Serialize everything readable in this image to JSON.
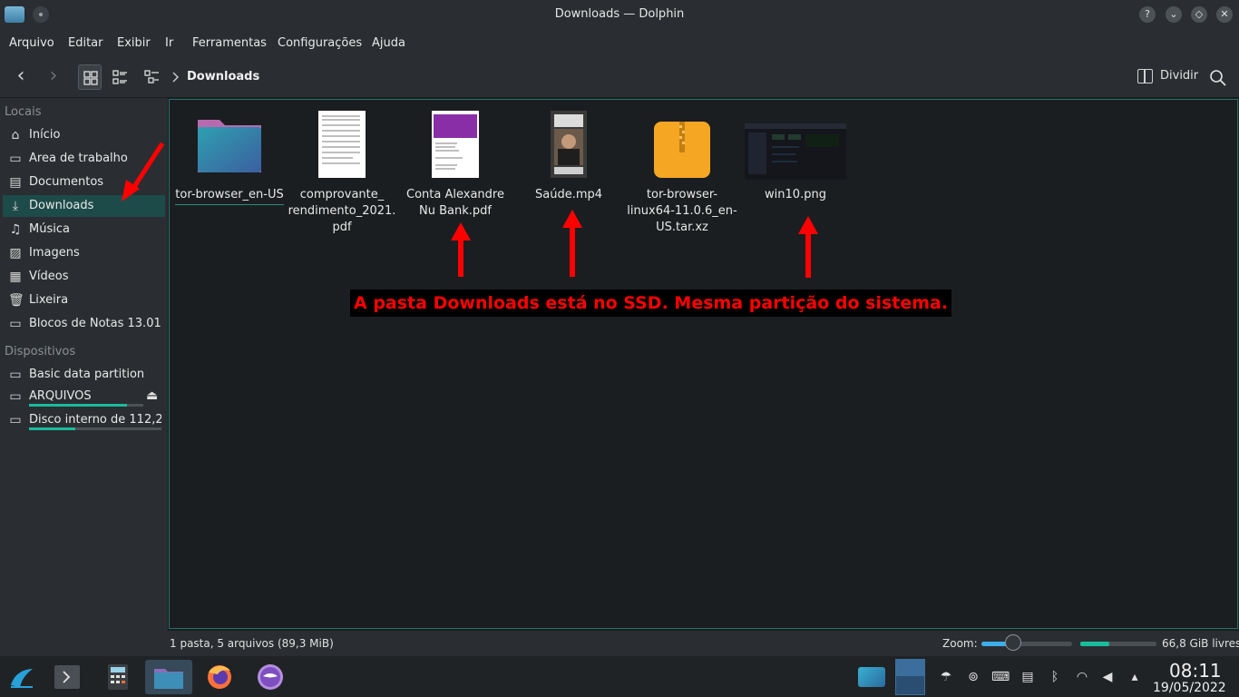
{
  "window": {
    "title": "Downloads — Dolphin",
    "buttons": [
      "?",
      "⌄",
      "◇",
      "✕"
    ]
  },
  "menu": [
    "Arquivo",
    "Editar",
    "Exibir",
    "Ir",
    "Ferramentas",
    "Configurações",
    "Ajuda"
  ],
  "toolbar": {
    "back_icon": "‹",
    "forward_icon": "›",
    "breadcrumb": "Downloads",
    "split_label": "Dividir"
  },
  "sidebar": {
    "places_header": "Locais",
    "places": [
      {
        "label": "Início",
        "icon": "home-icon",
        "glyph": "⌂"
      },
      {
        "label": "Área de trabalho",
        "icon": "desktop-icon",
        "glyph": "▭"
      },
      {
        "label": "Documentos",
        "icon": "documents-icon",
        "glyph": "▤"
      },
      {
        "label": "Downloads",
        "icon": "download-icon",
        "glyph": "⤓"
      },
      {
        "label": "Música",
        "icon": "music-icon",
        "glyph": "♫"
      },
      {
        "label": "Imagens",
        "icon": "pictures-icon",
        "glyph": "▨"
      },
      {
        "label": "Vídeos",
        "icon": "videos-icon",
        "glyph": "▦"
      },
      {
        "label": "Lixeira",
        "icon": "trash-icon",
        "glyph": "🗑"
      },
      {
        "label": "Blocos de Notas 13.01....",
        "icon": "folder-icon",
        "glyph": "▭"
      }
    ],
    "devices_header": "Dispositivos",
    "devices": [
      {
        "label": "Basic data partition",
        "icon": "drive-icon",
        "glyph": "▭",
        "usage": null
      },
      {
        "label": "ARQUIVOS",
        "icon": "drive-icon",
        "glyph": "▭",
        "usage": 0.86
      },
      {
        "label": "Disco interno de 112,2 ...",
        "icon": "ssd-icon",
        "glyph": "▭",
        "usage": 0.35
      }
    ],
    "eject_icon": "⏏"
  },
  "files": [
    {
      "name": "tor-browser_en-US",
      "type": "folder"
    },
    {
      "name": "comprovante_ rendimento_2021. pdf",
      "type": "pdf-receipt"
    },
    {
      "name": "Conta Alexandre Nu Bank.pdf",
      "type": "pdf-nubank"
    },
    {
      "name": "Saúde.mp4",
      "type": "video"
    },
    {
      "name": "tor-browser- linux64-11.0.6_en- US.tar.xz",
      "type": "archive"
    },
    {
      "name": "win10.png",
      "type": "image"
    }
  ],
  "annotation": "A pasta Downloads está no SSD. Mesma partição do sistema.",
  "status": {
    "summary": "1 pasta, 5 arquivos (89,3 MiB)",
    "zoom_label": "Zoom:",
    "zoom_level": 0.35,
    "free_space": "66,8 GiB livres",
    "used_fraction": 0.38
  },
  "taskbar": {
    "time": "08:11",
    "date": "19/05/2022"
  },
  "colors": {
    "accent": "#1abc9c",
    "selection": "#1d4b49",
    "annotation_text": "#ff0000",
    "arrow": "#ff0000"
  }
}
